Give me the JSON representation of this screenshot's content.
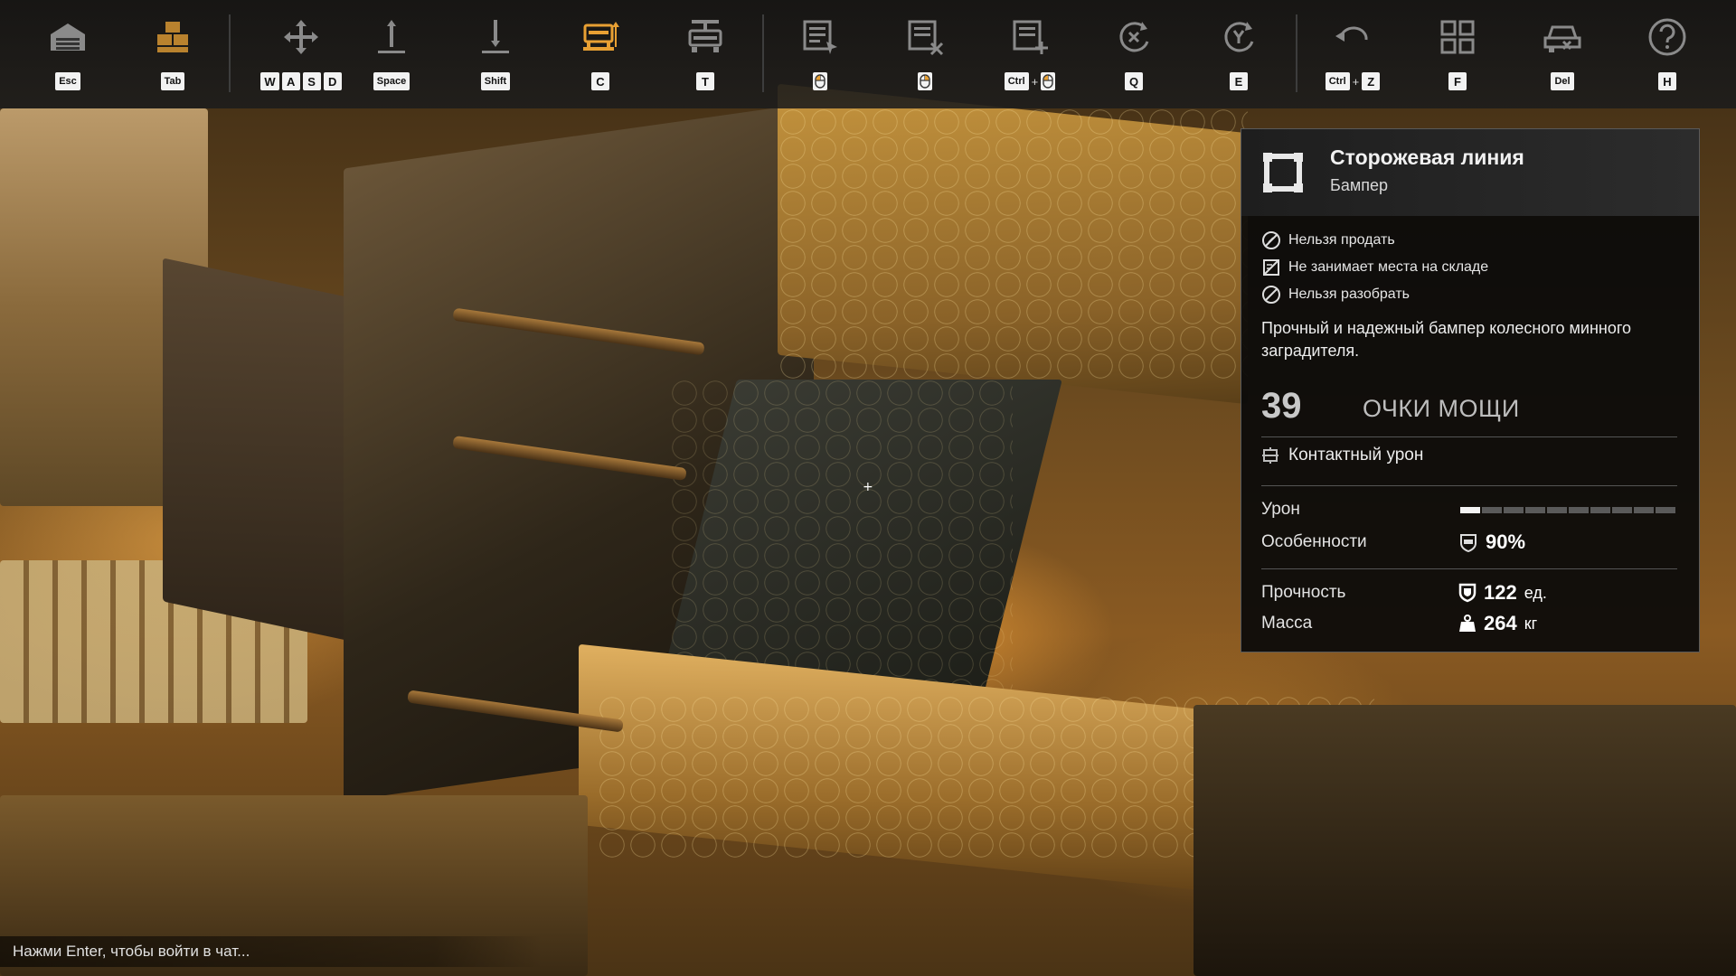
{
  "toolbar": {
    "tools": [
      {
        "name": "garage-icon",
        "keys": [
          "Esc"
        ]
      },
      {
        "name": "inventory-icon",
        "keys": [
          "Tab"
        ]
      },
      {
        "name": "move-icon",
        "keys": [
          "W",
          "A",
          "S",
          "D"
        ]
      },
      {
        "name": "raise-camera-icon",
        "keys": [
          "Space"
        ]
      },
      {
        "name": "lower-camera-icon",
        "keys": [
          "Shift"
        ]
      },
      {
        "name": "vehicle-lift-icon",
        "keys": [
          "C"
        ]
      },
      {
        "name": "vehicle-test-icon",
        "keys": [
          "T"
        ]
      },
      {
        "name": "place-part-icon",
        "keys": [
          "LMB"
        ]
      },
      {
        "name": "remove-part-icon",
        "keys": [
          "RMB"
        ]
      },
      {
        "name": "multi-place-icon",
        "keys": [
          "Ctrl",
          "+",
          "LMB"
        ]
      },
      {
        "name": "rotate-x-icon",
        "keys": [
          "Q"
        ]
      },
      {
        "name": "rotate-y-icon",
        "keys": [
          "E"
        ]
      },
      {
        "name": "undo-icon",
        "keys": [
          "Ctrl",
          "+",
          "Z"
        ]
      },
      {
        "name": "grid-icon",
        "keys": [
          "F"
        ]
      },
      {
        "name": "delete-vehicle-icon",
        "keys": [
          "Del"
        ]
      },
      {
        "name": "help-icon",
        "keys": [
          "H"
        ]
      }
    ]
  },
  "item": {
    "name": "Сторожевая линия",
    "type": "Бампер",
    "restrictions": [
      "Нельзя продать",
      "Не занимает места на складе",
      "Нельзя разобрать"
    ],
    "description": "Прочный и надежный бампер колесного минного заградителя.",
    "power_score": "39",
    "power_label": "ОЧКИ МОЩИ",
    "damage_type": "Контактный урон",
    "stats": {
      "damage_label": "Урон",
      "damage_level": 0.1,
      "features_label": "Особенности",
      "features_value": "90%",
      "durability_label": "Прочность",
      "durability_value": "122",
      "durability_unit": "ед.",
      "mass_label": "Масса",
      "mass_value": "264",
      "mass_unit": "кг"
    }
  },
  "chat": {
    "hint": "Нажми Enter, чтобы войти в чат..."
  },
  "colors": {
    "accent": "#e8a033",
    "icon": "#8a8a8a"
  }
}
